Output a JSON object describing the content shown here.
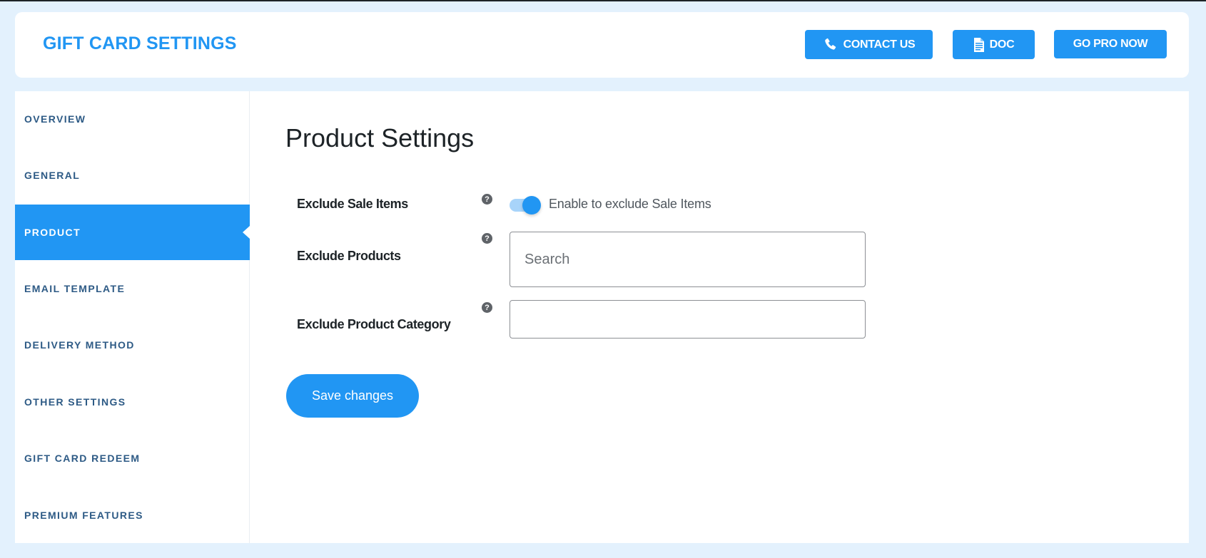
{
  "header": {
    "title": "GIFT CARD SETTINGS",
    "buttons": {
      "contact": {
        "label": "CONTACT US",
        "icon": "phone-icon"
      },
      "doc": {
        "label": "DOC",
        "icon": "document-icon"
      },
      "pro": {
        "label": "GO PRO NOW"
      }
    }
  },
  "sidebar": {
    "items": [
      {
        "label": "OVERVIEW",
        "active": false
      },
      {
        "label": "GENERAL",
        "active": false
      },
      {
        "label": "PRODUCT",
        "active": true
      },
      {
        "label": "EMAIL TEMPLATE",
        "active": false
      },
      {
        "label": "DELIVERY METHOD",
        "active": false
      },
      {
        "label": "OTHER SETTINGS",
        "active": false
      },
      {
        "label": "GIFT CARD REDEEM",
        "active": false
      },
      {
        "label": "PREMIUM FEATURES",
        "active": false
      }
    ]
  },
  "main": {
    "title": "Product Settings",
    "fields": {
      "exclude_sale_items": {
        "label": "Exclude Sale Items",
        "toggle_on": true,
        "description": "Enable to exclude Sale Items",
        "help": "?"
      },
      "exclude_products": {
        "label": "Exclude Products",
        "value": "",
        "placeholder": "Search",
        "help": "?"
      },
      "exclude_product_category": {
        "label": "Exclude Product Category",
        "value": "",
        "placeholder": "",
        "help": "?"
      }
    },
    "save_label": "Save changes"
  },
  "colors": {
    "accent": "#2196f3",
    "background": "#e3f1fd",
    "nav_text": "#2d5a85"
  }
}
